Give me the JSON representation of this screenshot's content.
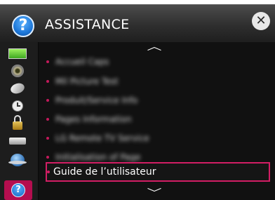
{
  "header": {
    "title": "ASSISTANCE",
    "help_icon": "help-icon",
    "help_glyph": "?",
    "close_glyph": "✕"
  },
  "sidebar": {
    "items": [
      {
        "name": "picture",
        "icon": "monitor-icon"
      },
      {
        "name": "sound",
        "icon": "speaker-icon"
      },
      {
        "name": "channels",
        "icon": "satellite-icon"
      },
      {
        "name": "time",
        "icon": "clock-icon"
      },
      {
        "name": "lock",
        "icon": "lock-icon"
      },
      {
        "name": "option",
        "icon": "remote-icon"
      },
      {
        "name": "network",
        "icon": "globe-icon"
      },
      {
        "name": "support",
        "icon": "help-icon",
        "glyph": "?",
        "selected": true
      }
    ]
  },
  "menu": {
    "scroll_up": "︿",
    "scroll_down": "﹀",
    "items": [
      {
        "label": "Accueil Caps",
        "blurred": true
      },
      {
        "label": "Mil Picture Test",
        "blurred": true
      },
      {
        "label": "Produit/Service Info",
        "blurred": true
      },
      {
        "label": "Pages Information",
        "blurred": true
      },
      {
        "label": "LG Remote TV Service",
        "blurred": true
      },
      {
        "label": "Initialisation of Page",
        "blurred": true
      },
      {
        "label": "Guide de l’utilisateur",
        "blurred": false,
        "selected": true
      }
    ]
  },
  "colors": {
    "accent": "#d21e64",
    "bullet": "#c31a5b",
    "content_bg": "#111111",
    "sidebar_bg": "#1d1d1d",
    "header_bg": "#2e2e2e"
  }
}
